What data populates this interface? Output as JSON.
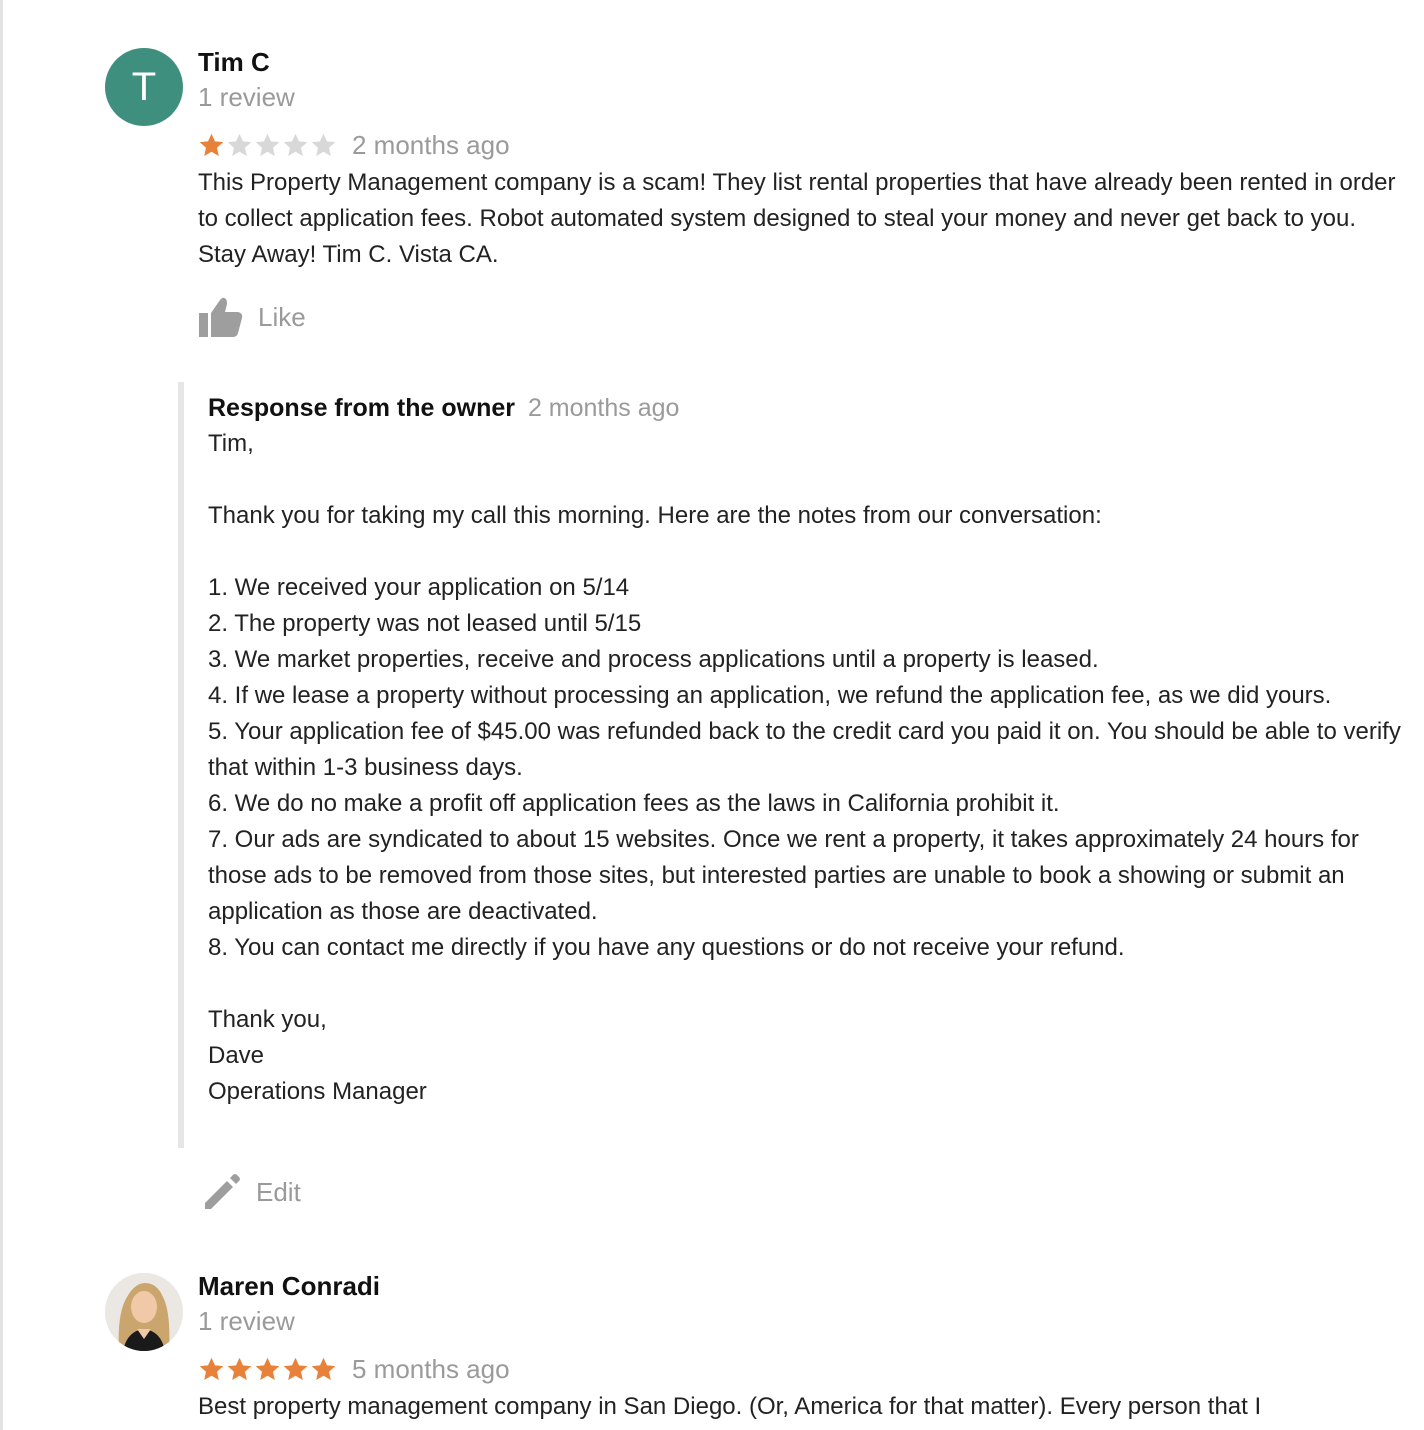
{
  "reviews": [
    {
      "avatar_letter": "T",
      "avatar_color": "#3f8f7f",
      "name": "Tim C",
      "review_count": "1 review",
      "rating": 1,
      "time": "2 months ago",
      "text": "This Property Management company is a scam!  They list rental properties that have already been rented in order to collect application fees.  Robot automated system designed to steal your money and never get back to you.  Stay Away!  Tim C. Vista CA.",
      "like_label": "Like",
      "owner_response": {
        "title": "Response from the owner",
        "time": "2 months ago",
        "text": "Tim,\n\nThank you for taking my call this morning. Here are the notes from our conversation:\n\n1. We received your application on 5/14\n2. The property was not leased until 5/15\n3. We market properties, receive and process applications until a property is leased.\n4. If we lease a property without processing an application, we refund the application fee, as we did yours.\n5. Your application fee of $45.00 was refunded back to the credit card you paid it on. You should be able to verify that within 1-3 business days.\n6. We do no make a profit off application fees as the laws in California prohibit it.\n7. Our ads are syndicated to about 15 websites. Once we rent a property, it takes approximately 24 hours for those ads to be removed from those sites, but interested parties are unable to book a showing or submit an application as those are deactivated.\n8. You can contact me directly if you have any questions or do not receive your refund.\n\nThank you,\nDave\nOperations Manager",
        "edit_label": "Edit"
      }
    },
    {
      "avatar_type": "photo",
      "name": "Maren Conradi",
      "review_count": "1 review",
      "rating": 5,
      "time": "5 months ago",
      "text": "Best property management company in San Diego. (Or, America for that matter). Every person that I"
    }
  ],
  "colors": {
    "star_filled": "#e8823a",
    "star_empty": "#d8d8d8",
    "muted_text": "#9a9a9a",
    "icon_gray": "#9e9e9e"
  }
}
